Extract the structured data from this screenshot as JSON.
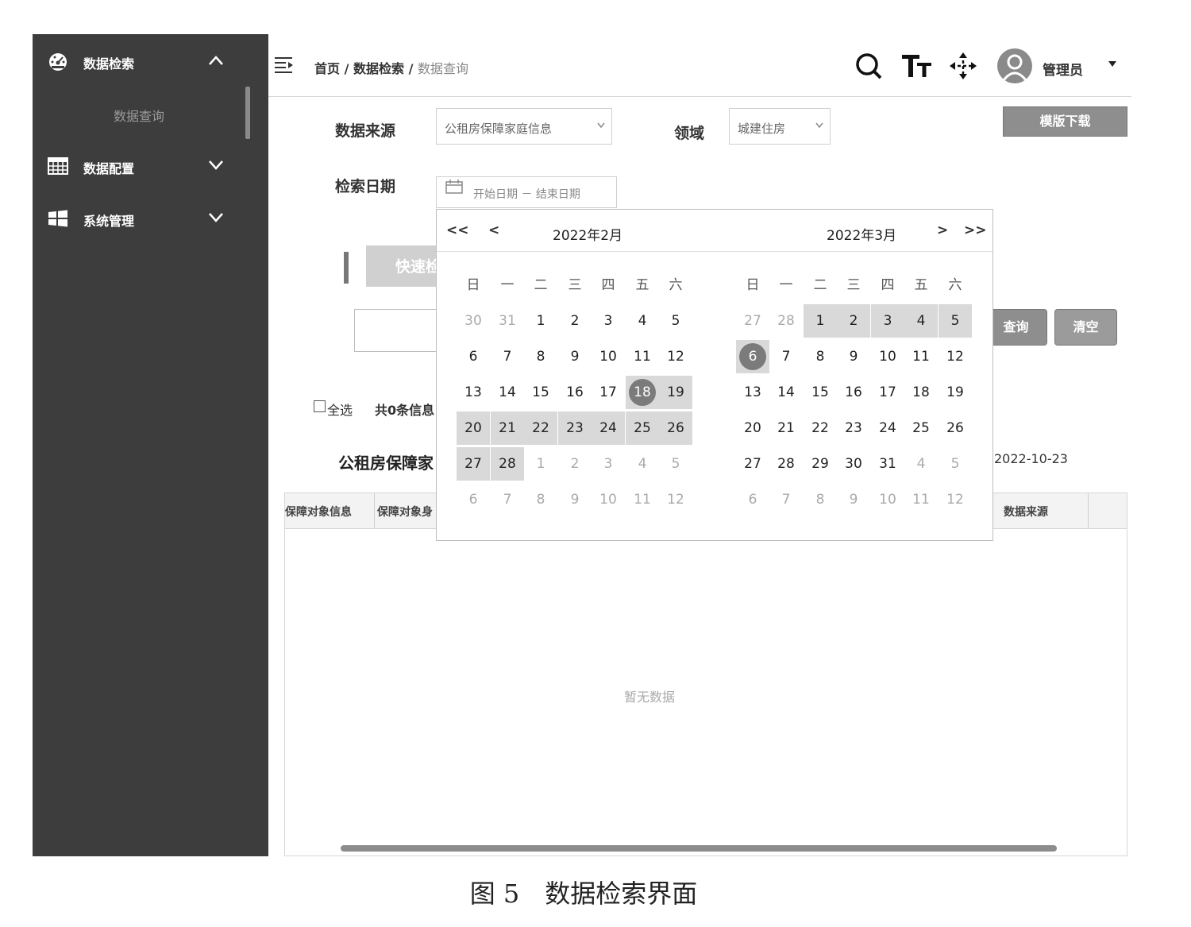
{
  "sidebar": {
    "items": [
      {
        "label": "数据检索",
        "icon": "dashboard-icon",
        "state": "expanded"
      },
      {
        "label": "数据配置",
        "icon": "table-icon",
        "state": "collapsed"
      },
      {
        "label": "系统管理",
        "icon": "windows-icon",
        "state": "collapsed"
      }
    ],
    "sub_items": [
      "数据查询"
    ]
  },
  "header": {
    "breadcrumb": {
      "home": "首页",
      "sep": " / ",
      "section": "数据检索",
      "current": "数据查询"
    },
    "user": "管理员"
  },
  "form": {
    "source_label": "数据来源",
    "source_value": "公租房保障家庭信息",
    "domain_label": "领域",
    "domain_value": "城建住房",
    "template_button": "模版下载",
    "date_label": "检索日期",
    "date_placeholder": "开始日期 － 结束日期",
    "quick_button": "快速检",
    "query_button": "查询",
    "clear_button": "清空",
    "select_all": "全选",
    "count_text": "共0条信息",
    "section_title": "公租房保障家",
    "date_text": "2022-10-23"
  },
  "calendar": {
    "nav": {
      "prev_year": "<<",
      "prev_month": "<",
      "next_month": ">",
      "next_year": ">>"
    },
    "weekdays": [
      "日",
      "一",
      "二",
      "三",
      "四",
      "五",
      "六"
    ],
    "months": [
      {
        "title": "2022年2月",
        "days": [
          [
            "30",
            "31",
            "1",
            "2",
            "3",
            "4",
            "5"
          ],
          [
            "6",
            "7",
            "8",
            "9",
            "10",
            "11",
            "12"
          ],
          [
            "13",
            "14",
            "15",
            "16",
            "17",
            "18",
            "19"
          ],
          [
            "20",
            "21",
            "22",
            "23",
            "24",
            "25",
            "26"
          ],
          [
            "27",
            "28",
            "1",
            "2",
            "3",
            "4",
            "5"
          ],
          [
            "6",
            "7",
            "8",
            "9",
            "10",
            "11",
            "12"
          ]
        ]
      },
      {
        "title": "2022年3月",
        "days": [
          [
            "27",
            "28",
            "1",
            "2",
            "3",
            "4",
            "5"
          ],
          [
            "6",
            "7",
            "8",
            "9",
            "10",
            "11",
            "12"
          ],
          [
            "13",
            "14",
            "15",
            "16",
            "17",
            "18",
            "19"
          ],
          [
            "20",
            "21",
            "22",
            "23",
            "24",
            "25",
            "26"
          ],
          [
            "27",
            "28",
            "29",
            "30",
            "31",
            "4",
            "5"
          ],
          [
            "6",
            "7",
            "8",
            "9",
            "10",
            "11",
            "12"
          ]
        ]
      }
    ]
  },
  "table": {
    "columns": [
      "保障对象信息",
      "保障对象身",
      "数据来源"
    ],
    "empty_text": "暂无数据"
  },
  "caption": "图 5　数据检索界面"
}
